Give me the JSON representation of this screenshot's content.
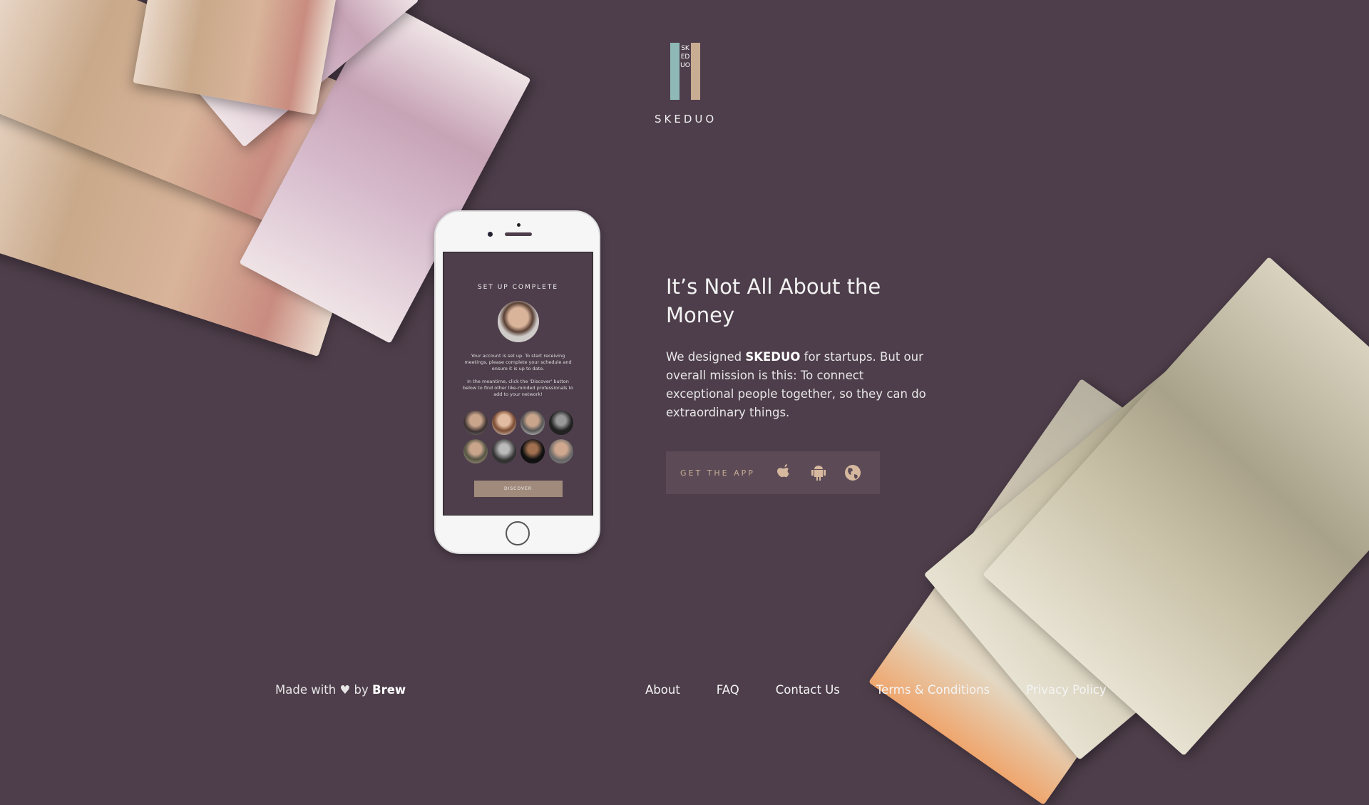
{
  "brand": {
    "name": "SKEDUO",
    "logo_vertical": "SKEDUO",
    "colors": [
      "#8fb9b7",
      "#c8ad93"
    ]
  },
  "phone": {
    "title": "SET UP COMPLETE",
    "text1": "Your account is set up. To start receiving meetings, please complete your schedule and ensure it is up to date.",
    "text2": "In the meantime, click the 'Discover' button below to find other like-minded professionals to add to your network!",
    "button": "DISCOVER"
  },
  "hero": {
    "headline": "It’s Not All About the Money",
    "para_pre": "We designed ",
    "para_brand": "SKEDUO",
    "para_post": " for startups. But our overall mission is this: To connect exceptional people together, so they can do extraordinary things."
  },
  "app": {
    "label": "GET THE APP",
    "icons": [
      "apple-icon",
      "android-icon",
      "globe-icon"
    ]
  },
  "footer": {
    "made_pre": "Made with",
    "heart": "♥",
    "made_by": "by",
    "made_brand": "Brew",
    "links": [
      "About",
      "FAQ",
      "Contact Us",
      "Terms & Conditions",
      "Privacy Policy"
    ]
  },
  "colors": {
    "background": "#4e3e4b",
    "accent": "#c8ad93"
  }
}
